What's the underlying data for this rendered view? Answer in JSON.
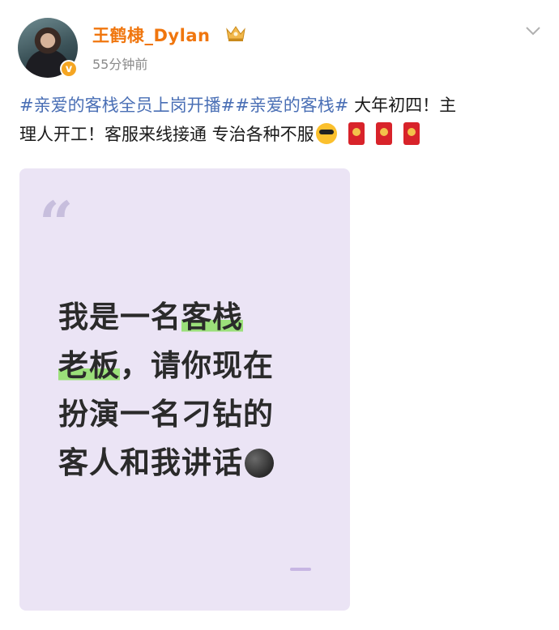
{
  "post": {
    "author": {
      "name": "王鹤棣_Dylan",
      "avatar_icon": "avatar",
      "verified_icon": "verified-badge-icon",
      "crown_icon": "vip-crown-icon"
    },
    "timestamp": "55分钟前",
    "text": {
      "topic1": "#亲爱的客栈全员上岗开播#",
      "topic2": "#亲爱的客栈#",
      "body_line1": " 大年初四！主",
      "body_line2": "理人开工！客服来线接通 专治各种不服"
    },
    "emojis": [
      "sunglasses-emoji",
      "red-envelope-emoji",
      "red-envelope-emoji",
      "red-envelope-emoji"
    ],
    "image_card": {
      "quote_mark": "“",
      "lines": [
        {
          "pre": "我是一名",
          "hl": "客栈",
          "post": ""
        },
        {
          "pre": "",
          "hl": "老板",
          "post": "，请你现在"
        },
        {
          "pre": "扮演一名刁钻的",
          "hl": "",
          "post": ""
        },
        {
          "pre": "客人和我讲话",
          "hl": "",
          "post": ""
        }
      ],
      "moon_icon": "dark-moon-emoji",
      "background_color": "#ebe4f5",
      "highlight_color": "#9be07a"
    }
  },
  "colors": {
    "username": "#f0760e",
    "topic": "#4a6fb5"
  }
}
